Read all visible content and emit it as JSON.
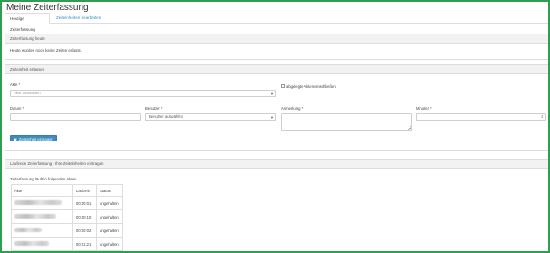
{
  "page_title": "Meine Zeiterfassung",
  "tabs": [
    {
      "label": "Heutige Zeiterfassung",
      "active": true
    },
    {
      "label": "Zeiteinheiten bearbeiten",
      "active": false
    }
  ],
  "panel_today": {
    "heading": "Zeiterfassung heute",
    "message": "Heute wurden noch keine Zeiten erfasst."
  },
  "panel_entry": {
    "heading": "Zeiteinheit erfassen",
    "akte_label": "Akte *",
    "akte_placeholder": "Akte auswählen",
    "checkbox_label": "abgelegte Akten einschließen",
    "datum_label": "Datum *",
    "datum_value": "",
    "benutzer_label": "Benutzer *",
    "benutzer_placeholder": "Benutzer auswählen",
    "anmerkung_label": "Anmerkung *",
    "minuten_label": "Minuten *",
    "submit_label": "Zeiteinheit eintragen"
  },
  "panel_running": {
    "heading": "Laufende Zeiterfassung - Ihre Zeiteinheiten eintragen",
    "subtitle": "Zeiterfassung läuft in folgenden Akten",
    "columns": [
      "Akte",
      "Laufzeit",
      "Status"
    ],
    "rows": [
      {
        "laufzeit": "00:00:01",
        "status": "angehalten"
      },
      {
        "laufzeit": "00:00:10",
        "status": "angehalten"
      },
      {
        "laufzeit": "00:00:02",
        "status": "angehalten"
      },
      {
        "laufzeit": "00:01:21",
        "status": "angehalten"
      }
    ]
  },
  "colors": {
    "frame_border": "#2f9e4f",
    "primary": "#3c8dbc",
    "panel_header": "#f2f2f2"
  }
}
